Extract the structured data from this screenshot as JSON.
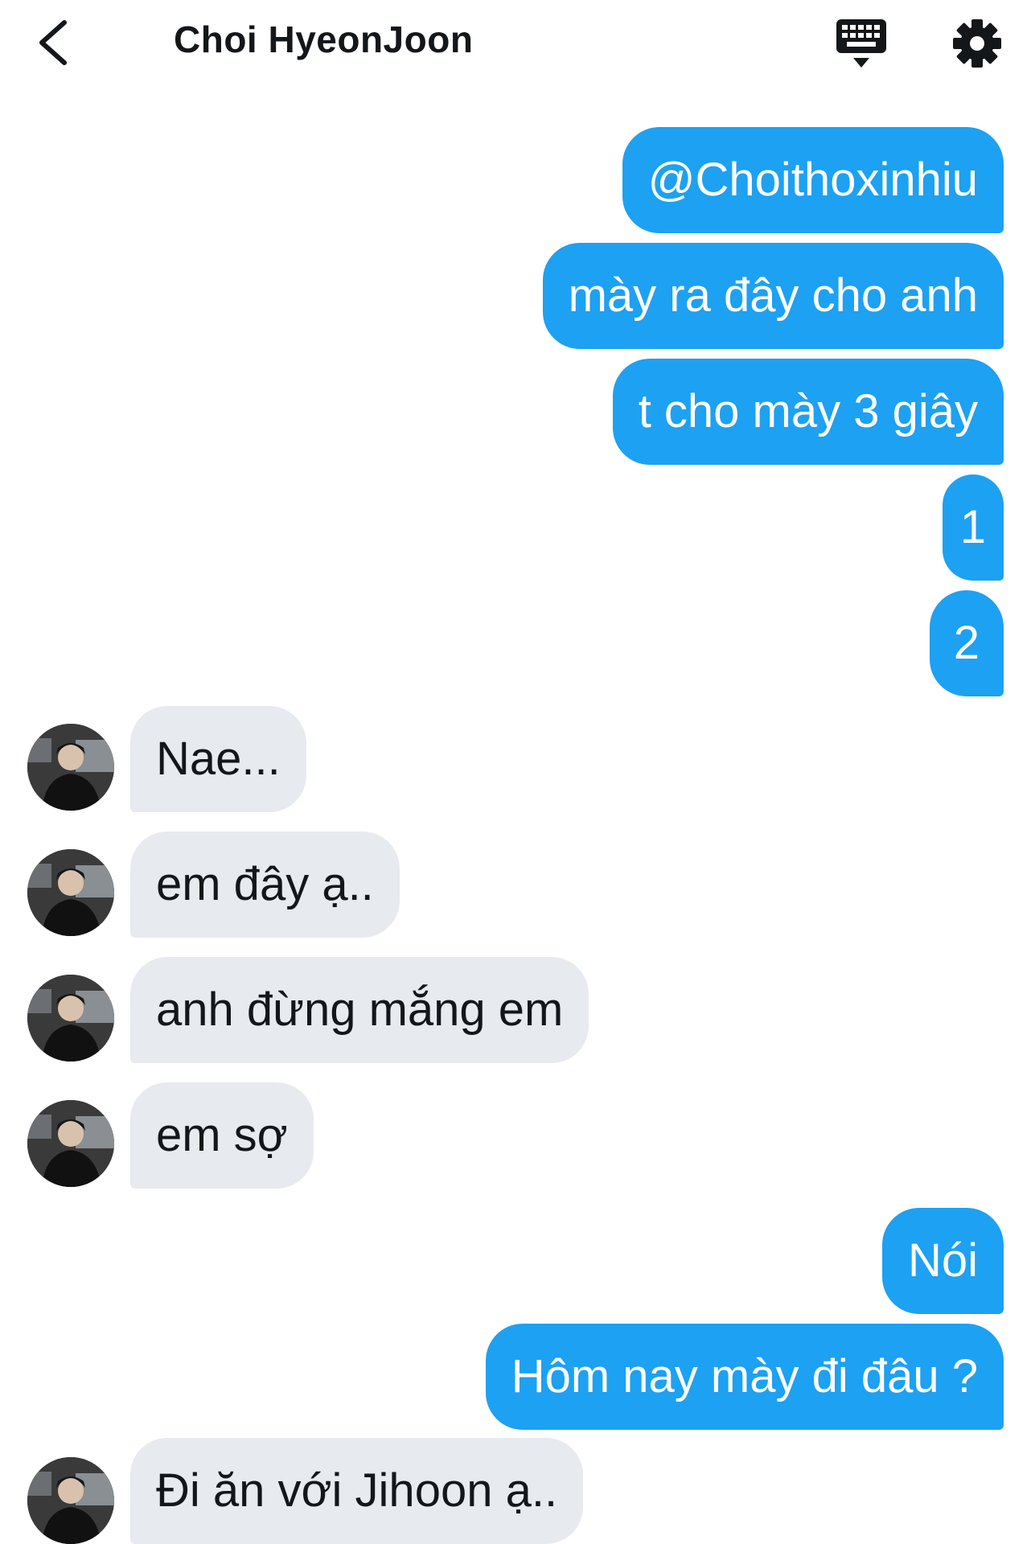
{
  "header": {
    "title": "Choi HyeonJoon",
    "back_icon": "chevron-left-icon",
    "keyboard_icon": "keyboard-icon",
    "settings_icon": "gear-icon"
  },
  "colors": {
    "sent_bubble": "#1da1f2",
    "received_bubble": "#e7eaef",
    "text_dark": "#14171a"
  },
  "messages": [
    {
      "side": "sent",
      "text": "@Choithoxinhiu"
    },
    {
      "side": "sent",
      "text": "mày ra đây cho anh"
    },
    {
      "side": "sent",
      "text": "t cho mày 3 giây"
    },
    {
      "side": "sent",
      "text": "1"
    },
    {
      "side": "sent",
      "text": "2"
    },
    {
      "side": "received",
      "text": "Nae..."
    },
    {
      "side": "received",
      "text": "em đây ạ.."
    },
    {
      "side": "received",
      "text": "anh đừng mắng em"
    },
    {
      "side": "received",
      "text": "em sợ"
    },
    {
      "side": "sent",
      "text": "Nói"
    },
    {
      "side": "sent",
      "text": "Hôm nay mày đi đâu ?"
    },
    {
      "side": "received",
      "text": "Đi ăn với Jihoon ạ.."
    }
  ]
}
